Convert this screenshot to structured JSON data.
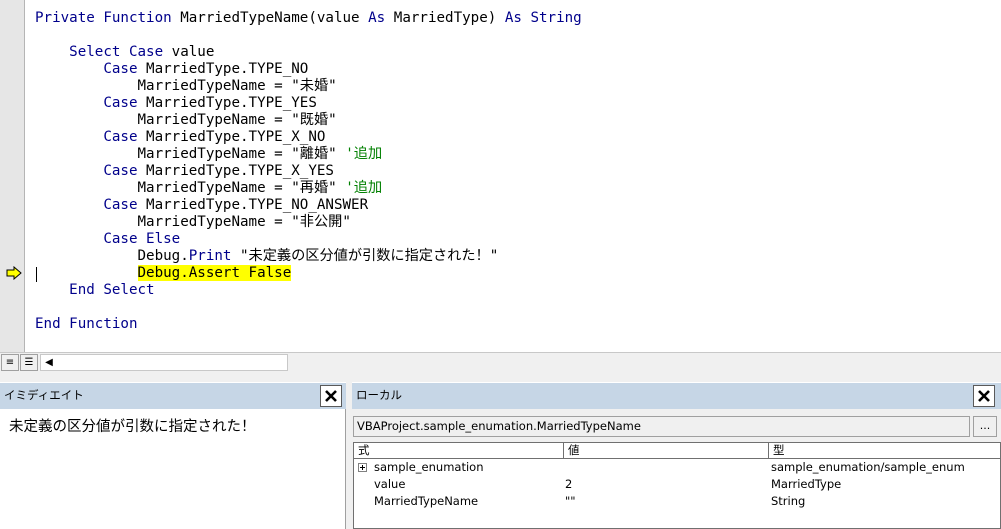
{
  "editor": {
    "lines": [
      [
        {
          "t": "Private Function ",
          "c": "kw"
        },
        {
          "t": "MarriedTypeName(value "
        },
        {
          "t": "As",
          "c": "kw"
        },
        {
          "t": " MarriedType) "
        },
        {
          "t": "As String",
          "c": "kw"
        }
      ],
      [],
      [
        {
          "t": "    "
        },
        {
          "t": "Select Case",
          "c": "kw"
        },
        {
          "t": " value"
        }
      ],
      [
        {
          "t": "        "
        },
        {
          "t": "Case",
          "c": "kw"
        },
        {
          "t": " MarriedType.TYPE_NO"
        }
      ],
      [
        {
          "t": "            MarriedTypeName = \"未婚\""
        }
      ],
      [
        {
          "t": "        "
        },
        {
          "t": "Case",
          "c": "kw"
        },
        {
          "t": " MarriedType.TYPE_YES"
        }
      ],
      [
        {
          "t": "            MarriedTypeName = \"既婚\""
        }
      ],
      [
        {
          "t": "        "
        },
        {
          "t": "Case",
          "c": "kw"
        },
        {
          "t": " MarriedType.TYPE_X_NO"
        }
      ],
      [
        {
          "t": "            MarriedTypeName = \"離婚\" "
        },
        {
          "t": "'追加",
          "c": "cm"
        }
      ],
      [
        {
          "t": "        "
        },
        {
          "t": "Case",
          "c": "kw"
        },
        {
          "t": " MarriedType.TYPE_X_YES"
        }
      ],
      [
        {
          "t": "            MarriedTypeName = \"再婚\" "
        },
        {
          "t": "'追加",
          "c": "cm"
        }
      ],
      [
        {
          "t": "        "
        },
        {
          "t": "Case",
          "c": "kw"
        },
        {
          "t": " MarriedType.TYPE_NO_ANSWER"
        }
      ],
      [
        {
          "t": "            MarriedTypeName = \"非公開\""
        }
      ],
      [
        {
          "t": "        "
        },
        {
          "t": "Case Else",
          "c": "kw"
        }
      ],
      [
        {
          "t": "            Debug."
        },
        {
          "t": "Print",
          "c": "kw"
        },
        {
          "t": " \"未定義の区分値が引数に指定された！\""
        }
      ],
      [
        {
          "t": "            "
        },
        {
          "t": "Debug.Assert False",
          "c": "hl"
        }
      ],
      [
        {
          "t": "    "
        },
        {
          "t": "End Select",
          "c": "kw"
        }
      ],
      [],
      [
        {
          "t": "End Function",
          "c": "kw"
        }
      ]
    ],
    "view_buttons": {
      "procedure": "≡",
      "module": "☰"
    },
    "scroll_left": "◀"
  },
  "immediate": {
    "title": "イミディエイト",
    "output": "未定義の区分値が引数に指定された！"
  },
  "locals": {
    "title": "ローカル",
    "context": "VBAProject.sample_enumation.MarriedTypeName",
    "context_button": "...",
    "columns": [
      "式",
      "値",
      "型"
    ],
    "rows": [
      {
        "expression": "sample_enumation",
        "value": "",
        "type": "sample_enumation/sample_enum",
        "expandable": true
      },
      {
        "expression": "value",
        "value": "2",
        "type": "MarriedType",
        "expandable": false
      },
      {
        "expression": "MarriedTypeName",
        "value": "\"\"",
        "type": "String",
        "expandable": false
      }
    ]
  },
  "colors": {
    "keyword": "#00008b",
    "comment": "#008000",
    "current_line_highlight": "#ffff00",
    "panel_title_bg": "#c6d6e6"
  },
  "icons": {
    "execution_pointer": "yellow-arrow-icon",
    "close": "close-icon",
    "expand": "expand-plus-icon"
  }
}
